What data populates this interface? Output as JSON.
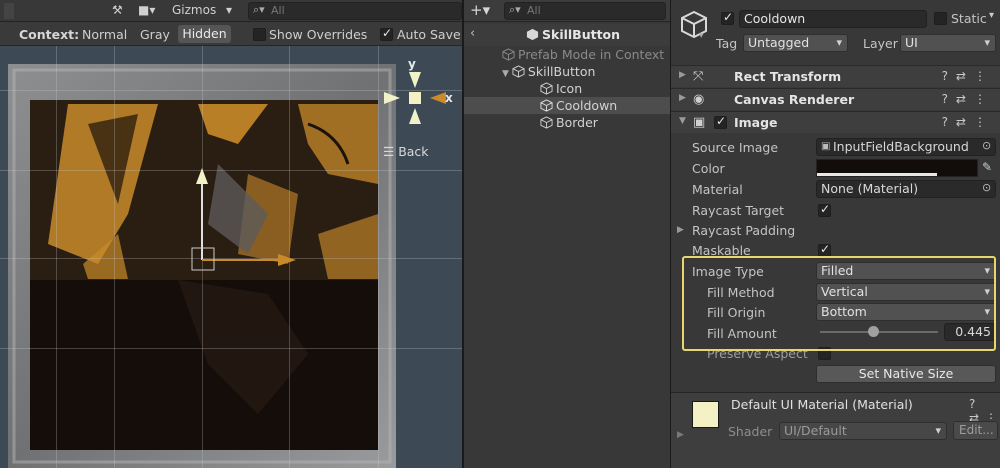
{
  "scene": {
    "toolbar": {
      "gizmos_label": "Gizmos",
      "search_placeholder": "All"
    },
    "context": {
      "label": "Context:",
      "modes": [
        "Normal",
        "Gray",
        "Hidden"
      ],
      "show_overrides": "Show Overrides",
      "auto_save": "Auto Save"
    },
    "axis": {
      "y": "y",
      "x": "x"
    },
    "back_label": "Back",
    "fill_amount_visible": 0.445
  },
  "hierarchy": {
    "search_placeholder": "All",
    "prefab_title": "SkillButton",
    "prefab_mode": "Prefab Mode in Context",
    "items": [
      "SkillButton",
      "Icon",
      "Cooldown",
      "Border"
    ],
    "selected": "Cooldown"
  },
  "inspector": {
    "name": "Cooldown",
    "static_label": "Static",
    "tag_label": "Tag",
    "tag_value": "Untagged",
    "layer_label": "Layer",
    "layer_value": "UI",
    "components": [
      "Rect Transform",
      "Canvas Renderer",
      "Image"
    ],
    "image": {
      "source_image_label": "Source Image",
      "source_image_value": "InputFieldBackground",
      "color_label": "Color",
      "color_value": "#120d0b",
      "material_label": "Material",
      "material_value": "None (Material)",
      "raycast_target_label": "Raycast Target",
      "raycast_padding_label": "Raycast Padding",
      "maskable_label": "Maskable",
      "image_type_label": "Image Type",
      "image_type_value": "Filled",
      "fill_method_label": "Fill Method",
      "fill_method_value": "Vertical",
      "fill_origin_label": "Fill Origin",
      "fill_origin_value": "Bottom",
      "fill_amount_label": "Fill Amount",
      "fill_amount_value": "0.445",
      "fill_amount_fraction": 0.445,
      "preserve_aspect_label": "Preserve Aspect",
      "set_native_size": "Set Native Size"
    },
    "material": {
      "title": "Default UI Material (Material)",
      "shader_label": "Shader",
      "shader_value": "UI/Default",
      "edit_label": "Edit..."
    }
  },
  "colors": {
    "highlight": "#e9d56c",
    "gold": "#c98b2a",
    "scene_bg": "#3d4a55"
  }
}
